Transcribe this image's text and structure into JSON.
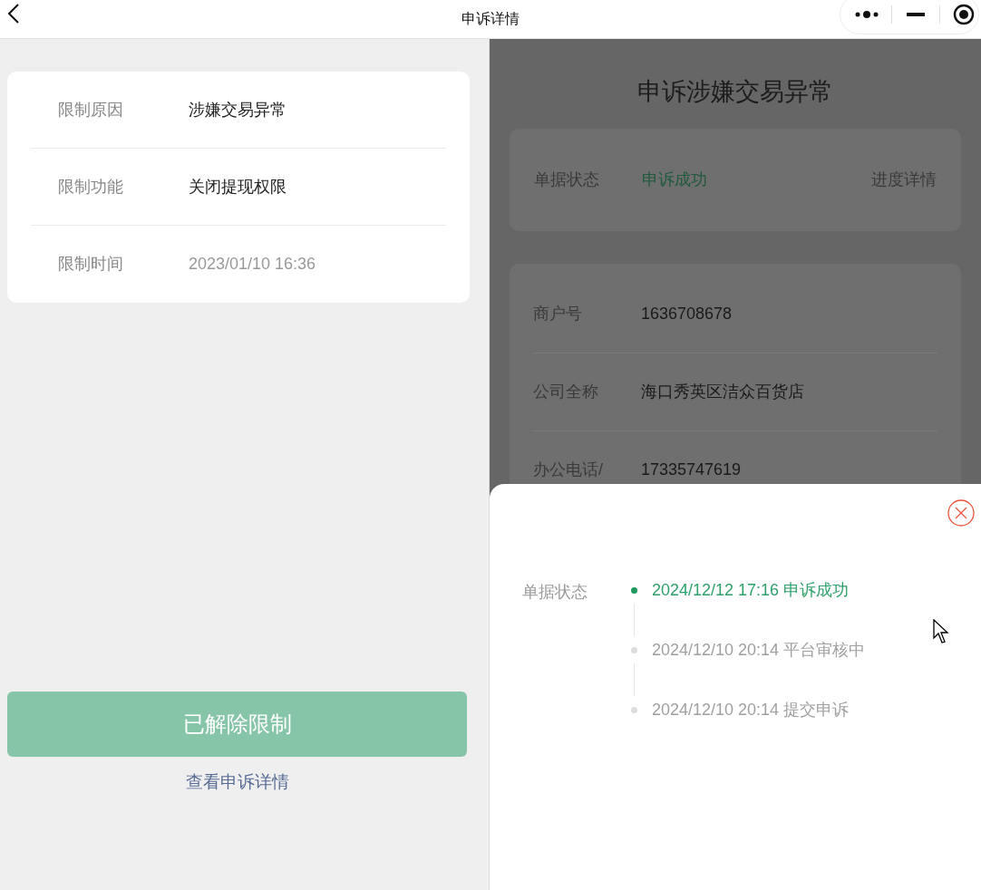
{
  "nav": {
    "title": "申诉详情"
  },
  "restriction": {
    "rows": [
      {
        "label": "限制原因",
        "value": "涉嫌交易异常",
        "kind": "text"
      },
      {
        "label": "限制功能",
        "value": "关闭提现权限",
        "kind": "text"
      },
      {
        "label": "限制时间",
        "value": "2023/01/10 16:36",
        "kind": "time"
      }
    ]
  },
  "status_button": {
    "label": "已解除限制",
    "disabled": true
  },
  "detail_link": "查看申诉详情",
  "appeal_page": {
    "title": "申诉涉嫌交易异常",
    "status": {
      "label": "单据状态",
      "value": "申诉成功",
      "link": "进度详情"
    },
    "rows": [
      {
        "label": "商户号",
        "value": "1636708678"
      },
      {
        "label": "公司全称",
        "value": "海口秀英区洁众百货店"
      },
      {
        "label": "办公电话/",
        "value": "17335747619"
      }
    ]
  },
  "progress_sheet": {
    "label": "单据状态",
    "steps": [
      {
        "text": "2024/12/12 17:16 申诉成功",
        "active": true
      },
      {
        "text": "2024/12/10 20:14 平台审核中",
        "active": false
      },
      {
        "text": "2024/12/10 20:14 提交申诉",
        "active": false
      }
    ]
  }
}
